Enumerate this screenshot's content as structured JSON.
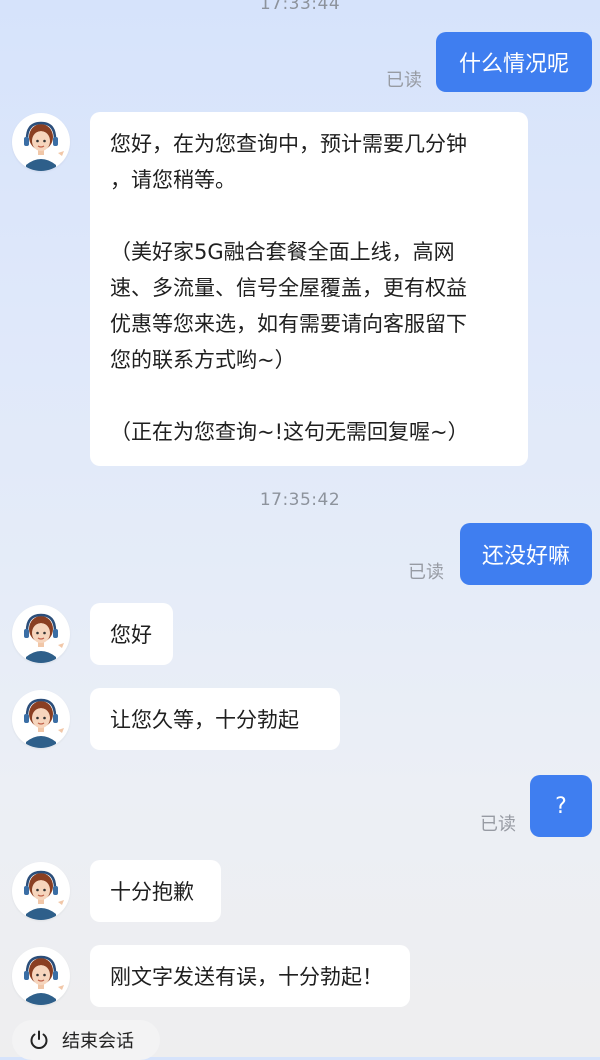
{
  "chat": {
    "timestamps": [
      "17:33:44",
      "17:35:42"
    ],
    "read_label": "已读",
    "messages": {
      "out1": "什么情况呢",
      "in_long": {
        "p1": "您好，在为您查询中，预计需要几分钟\n，请您稍等。",
        "p2": "（美好家5G融合套餐全面上线，高网\n速、多流量、信号全屋覆盖，更有权益\n优惠等您来选，如有需要请向客服留下\n您的联系方式哟~）",
        "p3": "（正在为您查询~!这句无需回复喔~）"
      },
      "out2": "还没好嘛",
      "in2": "您好",
      "in3": "让您久等，十分勃起",
      "out3": "?",
      "in4": "十分抱歉",
      "in5": "刚文字发送有误，十分勃起！"
    }
  },
  "footer": {
    "end_session_label": "结束会话",
    "end_icon": "power-icon"
  },
  "colors": {
    "accent": "#3f7ef0",
    "bubble_in": "#ffffff",
    "read_text": "#979ba3"
  }
}
